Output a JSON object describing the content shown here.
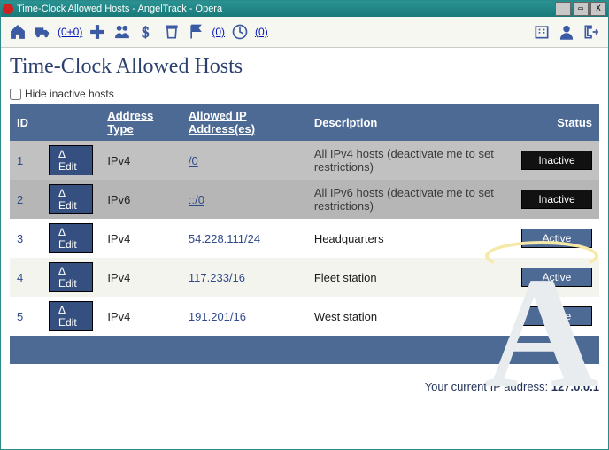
{
  "window": {
    "title": "Time-Clock Allowed Hosts - AngelTrack - Opera"
  },
  "toolbar": {
    "link1": "(0+0)",
    "link2": "(0)",
    "link3": "(0)"
  },
  "page": {
    "heading": "Time-Clock Allowed Hosts",
    "hide_inactive_label": "Hide inactive hosts",
    "hide_inactive_checked": false,
    "ip_prefix": "Your current IP address: ",
    "ip_value": "127.0.0.1"
  },
  "table": {
    "headers": {
      "id": "ID",
      "addr_type": "Address Type",
      "allowed": "Allowed IP Address(es)",
      "desc": "Description",
      "status": "Status"
    },
    "edit_label": "Δ Edit",
    "rows": [
      {
        "idx": "1",
        "addr_type": "IPv4",
        "allowed": "/0",
        "desc": "All IPv4 hosts (deactivate me to set restrictions)",
        "status": "Inactive",
        "gray": true,
        "zebra": 0
      },
      {
        "idx": "2",
        "addr_type": "IPv6",
        "allowed": "::/0",
        "desc": "All IPv6 hosts (deactivate me to set restrictions)",
        "status": "Inactive",
        "gray2": true,
        "zebra": 1
      },
      {
        "idx": "3",
        "addr_type": "IPv4",
        "allowed": "54.228.111/24",
        "desc": "Headquarters",
        "status": "Active",
        "zebra": 1
      },
      {
        "idx": "4",
        "addr_type": "IPv4",
        "allowed": "117.233/16",
        "desc": "Fleet station",
        "status": "Active",
        "zebra": 0
      },
      {
        "idx": "5",
        "addr_type": "IPv4",
        "allowed": "191.201/16",
        "desc": "West station",
        "status": "Active",
        "zebra": 1
      }
    ]
  }
}
